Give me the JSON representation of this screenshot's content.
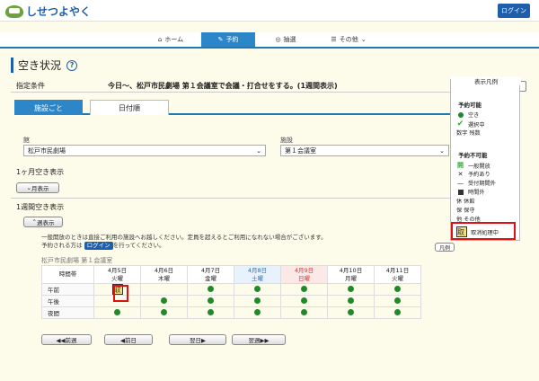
{
  "header": {
    "logo_text": "しせつよやく",
    "login_label": "ログイン"
  },
  "nav": {
    "items": [
      {
        "label": "ホーム",
        "icon": "home-icon"
      },
      {
        "label": "予約",
        "icon": "reserve-icon"
      },
      {
        "label": "抽選",
        "icon": "lottery-icon"
      },
      {
        "label": "その他",
        "icon": "list-icon"
      }
    ]
  },
  "page": {
    "title": "空き状況",
    "help": "?"
  },
  "condition": {
    "label": "指定条件",
    "text": "今日～、松戸市民劇場 第１会議室で会議・打合せをする。(1週間表示)"
  },
  "tabs": {
    "by_facility": "施設ごと",
    "by_date": "日付順"
  },
  "filters": {
    "building_label": "館",
    "building_value": "松戸市民劇場",
    "facility_label": "施設",
    "facility_value": "第１会議室"
  },
  "monthly": {
    "title": "1ヶ月空き表示",
    "button": "月表示"
  },
  "weekly": {
    "title": "1週間空き表示",
    "button": "週表示"
  },
  "notice": {
    "line1": "一般開放のときは直接ご利用の施設へお越しください。定員を超えるとご利用になれない場合がございます。",
    "line2_prefix": "予約される方は",
    "line2_login": "ログイン",
    "line2_suffix": "を行ってください。"
  },
  "legend_button": "凡例",
  "facility_title": "松戸市民劇場 第１会議室",
  "grid": {
    "time_header": "時間帯",
    "days": [
      {
        "date": "4月5日",
        "dow": "火曜",
        "type": "weekday"
      },
      {
        "date": "4月6日",
        "dow": "木曜",
        "type": "weekday"
      },
      {
        "date": "4月7日",
        "dow": "金曜",
        "type": "weekday"
      },
      {
        "date": "4月8日",
        "dow": "土曜",
        "type": "sat"
      },
      {
        "date": "4月9日",
        "dow": "日曜",
        "type": "sun"
      },
      {
        "date": "4月10日",
        "dow": "月曜",
        "type": "weekday"
      },
      {
        "date": "4月11日",
        "dow": "火曜",
        "type": "weekday"
      }
    ],
    "rows": [
      {
        "label": "午前",
        "cells": [
          "取",
          "",
          "●",
          "●",
          "●",
          "●",
          "●"
        ]
      },
      {
        "label": "午後",
        "cells": [
          "",
          "●",
          "●",
          "●",
          "●",
          "●",
          "●"
        ]
      },
      {
        "label": "夜間",
        "cells": [
          "●",
          "●",
          "●",
          "●",
          "●",
          "●",
          "●"
        ]
      }
    ]
  },
  "pager": {
    "prev_week": "◀◀前週",
    "prev_day": "◀前日",
    "next_day": "翌日▶",
    "next_week": "翌週▶▶"
  },
  "legend": {
    "header": "表示凡例",
    "available_title": "予約可能",
    "available": [
      {
        "icon": "green-dot-icon",
        "label": "空き"
      },
      {
        "icon": "check-icon",
        "label": "選択中"
      },
      {
        "icon": "number-icon",
        "label": "数字 残数"
      }
    ],
    "unavailable_title": "予約不可能",
    "unavailable": [
      {
        "icon": "open-icon",
        "label": "一般開放"
      },
      {
        "icon": "x-icon",
        "label": "予約あり"
      },
      {
        "icon": "dash-icon",
        "label": "受付期間外"
      },
      {
        "icon": "square-icon",
        "label": "時間外"
      },
      {
        "icon": "closed-icon",
        "label": "休 休館"
      },
      {
        "icon": "maintenance-icon",
        "label": "保 保守"
      },
      {
        "icon": "other-icon",
        "label": "他 その他"
      },
      {
        "icon": "cancel-processing-icon",
        "label": "取消処理中"
      }
    ],
    "cancel_glyph": "取"
  }
}
